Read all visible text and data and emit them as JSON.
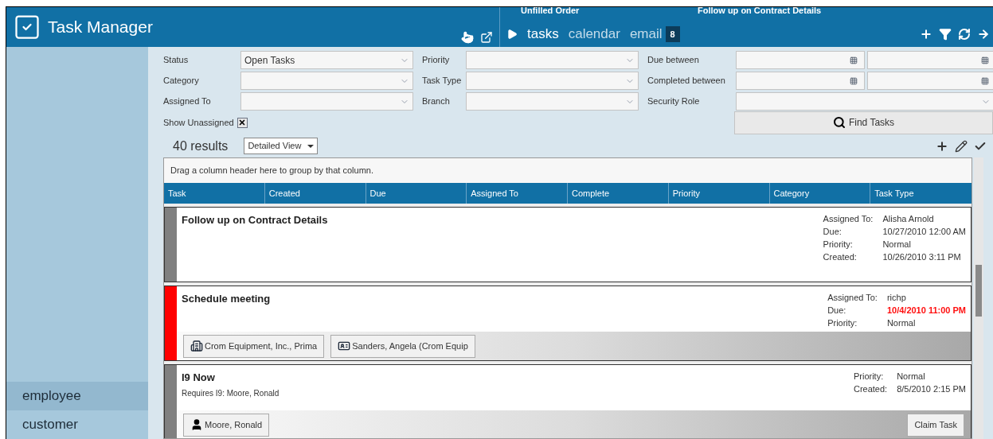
{
  "app": {
    "title": "Task Manager"
  },
  "open_tabs": [
    "Unfilled Order",
    "Follow up on Contract Details"
  ],
  "nav": [
    {
      "label": "tasks",
      "selected": true
    },
    {
      "label": "calendar",
      "selected": false
    },
    {
      "label": "email",
      "selected": false,
      "badge": "8"
    }
  ],
  "sidebar": {
    "items": [
      {
        "label": "employee",
        "selected": true
      },
      {
        "label": "customer",
        "selected": false
      }
    ]
  },
  "filters": [
    [
      {
        "label": "Status",
        "kind": "select",
        "value": "Open Tasks"
      },
      {
        "label": "Priority",
        "kind": "select"
      },
      {
        "label": "Due between",
        "kind": "daterange"
      }
    ],
    [
      {
        "label": "Category",
        "kind": "select"
      },
      {
        "label": "Task Type",
        "kind": "select"
      },
      {
        "label": "Completed between",
        "kind": "daterange"
      }
    ],
    [
      {
        "label": "Assigned To",
        "kind": "select"
      },
      {
        "label": "Branch",
        "kind": "select"
      },
      {
        "label": "Security Role",
        "kind": "wideselect"
      }
    ]
  ],
  "show_unassigned": {
    "label": "Show Unassigned",
    "checked": true
  },
  "find_button": "Find Tasks",
  "results": {
    "count": "40 results",
    "view": "Detailed View"
  },
  "grid": {
    "group_hint": "Drag a column header here to group by that column.",
    "columns": [
      "Task",
      "Created",
      "Due",
      "Assigned To",
      "Complete",
      "Priority",
      "Category",
      "Task Type"
    ],
    "cards": [
      {
        "title": "Follow up on Contract Details",
        "color": "#808080",
        "details": [
          {
            "label": "Assigned To:",
            "value": "Alisha Arnold",
            "overdue": false
          },
          {
            "label": "Due:",
            "value": "10/27/2010 12:00 AM",
            "overdue": false
          },
          {
            "label": "Priority:",
            "value": "Normal",
            "overdue": false
          },
          {
            "label": "Created:",
            "value": "10/26/2010 3:11 PM",
            "overdue": false
          }
        ]
      },
      {
        "title": "Schedule meeting",
        "color": "#ff0000",
        "details": [
          {
            "label": "Assigned To:",
            "value": "richp",
            "overdue": false
          },
          {
            "label": "Due:",
            "value": "10/4/2010 11:00 PM",
            "overdue": true
          },
          {
            "label": "Priority:",
            "value": "Normal",
            "overdue": false
          }
        ],
        "links": [
          {
            "kind": "company",
            "label": "Crom Equipment, Inc., Prima"
          },
          {
            "kind": "contact",
            "label": "Sanders, Angela (Crom Equip"
          }
        ]
      },
      {
        "title": "I9 Now",
        "subtitle": "Requires I9: Moore, Ronald",
        "color": "#808080",
        "details": [
          {
            "label": "Priority:",
            "value": "Normal",
            "overdue": false
          },
          {
            "label": "Created:",
            "value": "8/5/2010 2:15 PM",
            "overdue": false
          }
        ],
        "links": [
          {
            "kind": "person",
            "label": "Moore, Ronald"
          }
        ],
        "action": "Claim Task"
      }
    ]
  }
}
